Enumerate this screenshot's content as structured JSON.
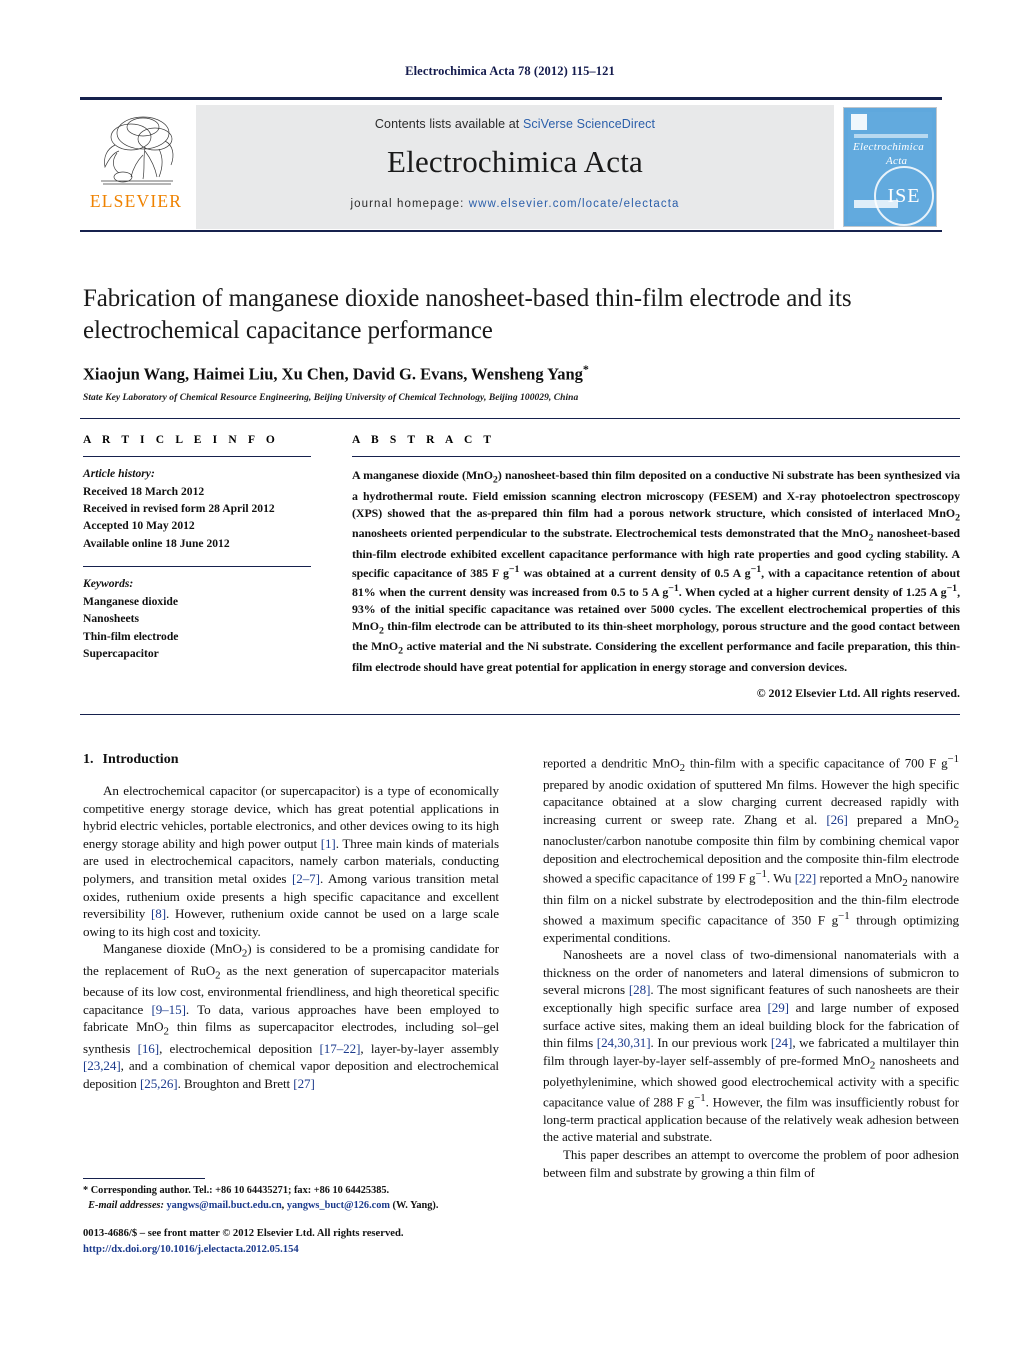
{
  "running_head": "Electrochimica Acta 78 (2012) 115–121",
  "masthead": {
    "contents_prefix": "Contents lists available at ",
    "sciencedirect": "SciVerse ScienceDirect",
    "journal_title": "Electrochimica Acta",
    "homepage_prefix": "journal homepage: ",
    "homepage_url": "www.elsevier.com/locate/electacta",
    "publisher_name": "ELSEVIER",
    "cover": {
      "title_line1": "Electrochimica",
      "title_line2": "Acta",
      "society_mark": "ISE"
    },
    "accent_link_color": "#2b5faa",
    "rule_color": "#16214d"
  },
  "article": {
    "title": "Fabrication of manganese dioxide nanosheet-based thin-film electrode and its electrochemical capacitance performance",
    "authors": "Xiaojun Wang, Haimei Liu, Xu Chen, David G. Evans, Wensheng Yang",
    "corresponding_marker": "*",
    "affiliation": "State Key Laboratory of Chemical Resource Engineering, Beijing University of Chemical Technology, Beijing 100029, China"
  },
  "article_info": {
    "heading": "A R T I C L E   I N F O",
    "history_label": "Article history:",
    "history": [
      "Received 18 March 2012",
      "Received in revised form 28 April 2012",
      "Accepted 10 May 2012",
      "Available online 18 June 2012"
    ],
    "keywords_label": "Keywords:",
    "keywords": [
      "Manganese dioxide",
      "Nanosheets",
      "Thin-film electrode",
      "Supercapacitor"
    ]
  },
  "abstract": {
    "heading": "A B S T R A C T",
    "text": "A manganese dioxide (MnO2) nanosheet-based thin film deposited on a conductive Ni substrate has been synthesized via a hydrothermal route. Field emission scanning electron microscopy (FESEM) and X-ray photoelectron spectroscopy (XPS) showed that the as-prepared thin film had a porous network structure, which consisted of interlaced MnO2 nanosheets oriented perpendicular to the substrate. Electrochemical tests demonstrated that the MnO2 nanosheet-based thin-film electrode exhibited excellent capacitance performance with high rate properties and good cycling stability. A specific capacitance of 385 F g−1 was obtained at a current density of 0.5 A g−1, with a capacitance retention of about 81% when the current density was increased from 0.5 to 5 A g−1. When cycled at a higher current density of 1.25 A g−1, 93% of the initial specific capacitance was retained over 5000 cycles. The excellent electrochemical properties of this MnO2 thin-film electrode can be attributed to its thin-sheet morphology, porous structure and the good contact between the MnO2 active material and the Ni substrate. Considering the excellent performance and facile preparation, this thin-film electrode should have great potential for application in energy storage and conversion devices.",
    "copyright": "© 2012 Elsevier Ltd. All rights reserved."
  },
  "body": {
    "section_number": "1.",
    "section_title": "Introduction",
    "left_paragraphs": [
      "An electrochemical capacitor (or supercapacitor) is a type of economically competitive energy storage device, which has great potential applications in hybrid electric vehicles, portable electronics, and other devices owing to its high energy storage ability and high power output [1]. Three main kinds of materials are used in electrochemical capacitors, namely carbon materials, conducting polymers, and transition metal oxides [2–7]. Among various transition metal oxides, ruthenium oxide presents a high specific capacitance and excellent reversibility [8]. However, ruthenium oxide cannot be used on a large scale owing to its high cost and toxicity.",
      "Manganese dioxide (MnO2) is considered to be a promising candidate for the replacement of RuO2 as the next generation of supercapacitor materials because of its low cost, environmental friendliness, and high theoretical specific capacitance [9–15]. To data, various approaches have been employed to fabricate MnO2 thin films as supercapacitor electrodes, including sol–gel synthesis [16], electrochemical deposition [17–22], layer-by-layer assembly [23,24], and a combination of chemical vapor deposition and electrochemical deposition [25,26]. Broughton and Brett [27]"
    ],
    "right_paragraphs": [
      "reported a dendritic MnO2 thin-film with a specific capacitance of 700 F g−1 prepared by anodic oxidation of sputtered Mn films. However the high specific capacitance obtained at a slow charging current decreased rapidly with increasing current or sweep rate. Zhang et al. [26] prepared a MnO2 nanocluster/carbon nanotube composite thin film by combining chemical vapor deposition and electrochemical deposition and the composite thin-film electrode showed a specific capacitance of 199 F g−1. Wu [22] reported a MnO2 nanowire thin film on a nickel substrate by electrodeposition and the thin-film electrode showed a maximum specific capacitance of 350 F g−1 through optimizing experimental conditions.",
      "Nanosheets are a novel class of two-dimensional nanomaterials with a thickness on the order of nanometers and lateral dimensions of submicron to several microns [28]. The most significant features of such nanosheets are their exceptionally high specific surface area [29] and large number of exposed surface active sites, making them an ideal building block for the fabrication of thin films [24,30,31]. In our previous work [24], we fabricated a multilayer thin film through layer-by-layer self-assembly of pre-formed MnO2 nanosheets and polyethylenimine, which showed good electrochemical activity with a specific capacitance value of 288 F g−1. However, the film was insufficiently robust for long-term practical application because of the relatively weak adhesion between the active material and substrate.",
      "This paper describes an attempt to overcome the problem of poor adhesion between film and substrate by growing a thin film of"
    ]
  },
  "footnote": {
    "marker": "*",
    "corresponding": "Corresponding author. Tel.: +86 10 64435271; fax: +86 10 64425385.",
    "email_label": "E-mail addresses:",
    "email1": "yangws@mail.buct.edu.cn",
    "email2": "yangws_buct@126.com",
    "email_owner": "(W. Yang)."
  },
  "page_footer": {
    "issn_line": "0013-4686/$ – see front matter © 2012 Elsevier Ltd. All rights reserved.",
    "doi": "http://dx.doi.org/10.1016/j.electacta.2012.05.154"
  }
}
